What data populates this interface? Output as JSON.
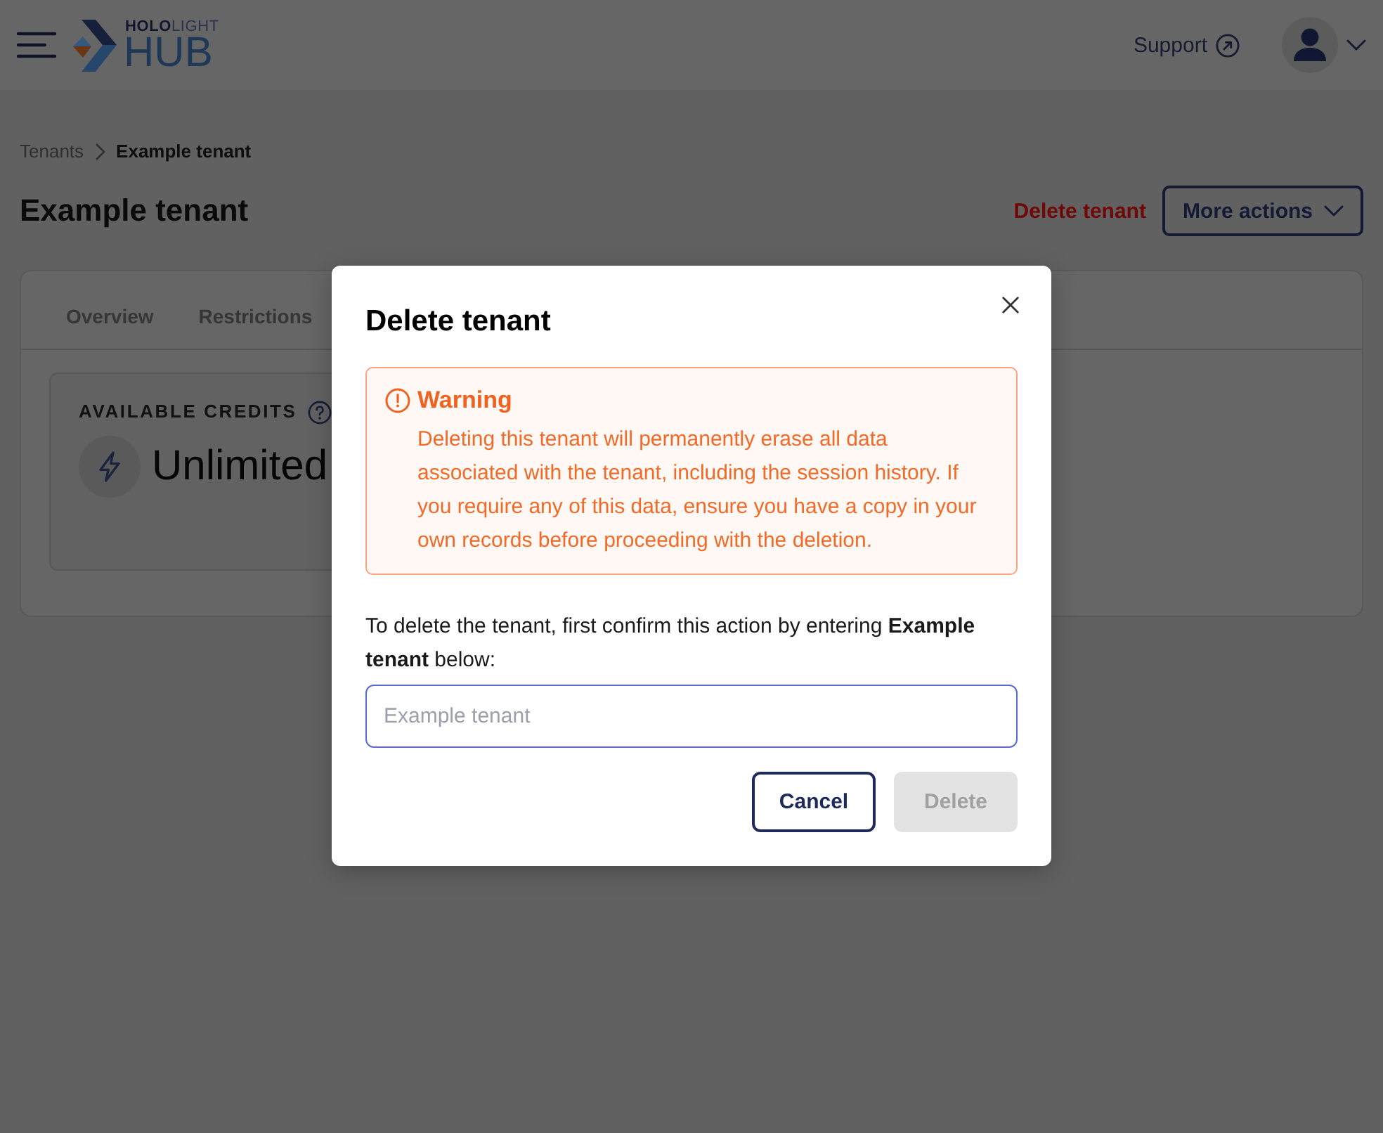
{
  "header": {
    "logo": {
      "brand": "**HOLO**LIGHT",
      "product": "HUB"
    },
    "support_link": "Support"
  },
  "breadcrumb": [
    {
      "label": "Tenants",
      "current": false
    },
    {
      "label": "Example tenant",
      "current": true
    }
  ],
  "page": {
    "title": "Example tenant",
    "actions": [
      {
        "kind": "danger-link",
        "label": "Delete tenant"
      },
      {
        "kind": "menu-button",
        "label": "More actions"
      }
    ]
  },
  "tabs": [
    {
      "label": "Overview",
      "selected": false
    },
    {
      "label": "Restrictions",
      "selected": false
    }
  ],
  "credits": {
    "label": "AVAILABLE CREDITS",
    "value": "Unlimited"
  },
  "dialog": {
    "title": "Delete tenant",
    "warning": {
      "title": "Warning",
      "text": "Deleting this tenant will permanently erase all data associated with the tenant, including the session history. If you require any of this data, ensure you have a copy in your own records before proceeding with the deletion."
    },
    "prompt": "To delete the tenant, first confirm this action by entering **Example tenant** below:",
    "input": {
      "placeholder": "Example tenant"
    },
    "buttons": [
      {
        "kind": "secondary",
        "label": "Cancel",
        "disabled": false
      },
      {
        "kind": "primary",
        "label": "Delete",
        "disabled": true
      }
    ]
  }
}
